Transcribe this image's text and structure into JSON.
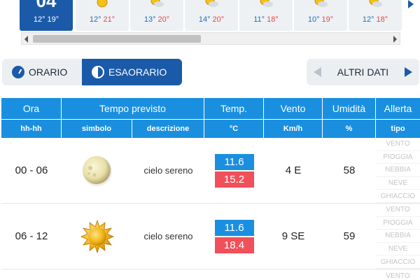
{
  "day_strip": {
    "days": [
      {
        "number": "04",
        "min": "12°",
        "max": "19°",
        "selected": true,
        "icon": "sun-icon"
      },
      {
        "number": "",
        "min": "12°",
        "max": "21°",
        "selected": false,
        "icon": "sun-icon"
      },
      {
        "number": "",
        "min": "13°",
        "max": "20°",
        "selected": false,
        "icon": "sun-cloud-icon"
      },
      {
        "number": "",
        "min": "14°",
        "max": "20°",
        "selected": false,
        "icon": "sun-cloud-icon"
      },
      {
        "number": "",
        "min": "11°",
        "max": "18°",
        "selected": false,
        "icon": "sun-cloud-icon"
      },
      {
        "number": "",
        "min": "10°",
        "max": "19°",
        "selected": false,
        "icon": "sun-cloud-icon"
      },
      {
        "number": "",
        "min": "12°",
        "max": "18°",
        "selected": false,
        "icon": "sun-cloud-icon"
      }
    ]
  },
  "view_toggle": {
    "orario_label": "ORARIO",
    "esaorario_label": "ESAORARIO",
    "active": "esaorario"
  },
  "altri_dati": {
    "label": "ALTRI DATI"
  },
  "table": {
    "headers": {
      "ora": "Ora",
      "tempo": "Tempo previsto",
      "temp": "Temp.",
      "vento": "Vento",
      "umidita": "Umidità",
      "allerta": "Allerta"
    },
    "subheaders": {
      "ora": "hh-hh",
      "simbolo": "simbolo",
      "descrizione": "descrizione",
      "temp": "°C",
      "vento": "Km/h",
      "umidita": "%",
      "allerta": "tipo"
    },
    "rows": [
      {
        "ora": "00 - 06",
        "icon": "moon-icon",
        "descrizione": "cielo sereno",
        "temp_min": "11.6",
        "temp_max": "15.2",
        "vento": "4 E",
        "umidita": "58",
        "alerts": [
          "VENTO",
          "PIOGGIA",
          "NEBBIA",
          "NEVE",
          "GHIACCIO"
        ]
      },
      {
        "ora": "06 - 12",
        "icon": "sun-icon",
        "descrizione": "cielo sereno",
        "temp_min": "11.6",
        "temp_max": "18.4",
        "vento": "9 SE",
        "umidita": "59",
        "alerts": [
          "VENTO",
          "PIOGGIA",
          "NEBBIA",
          "NEVE",
          "GHIACCIO"
        ]
      }
    ],
    "partial_row_alert": "VENTO"
  },
  "colors": {
    "primary": "#1a5aa8",
    "header": "#1a8fe0",
    "temp_min_bg": "#1a8fe0",
    "temp_max_bg": "#f0505a"
  }
}
